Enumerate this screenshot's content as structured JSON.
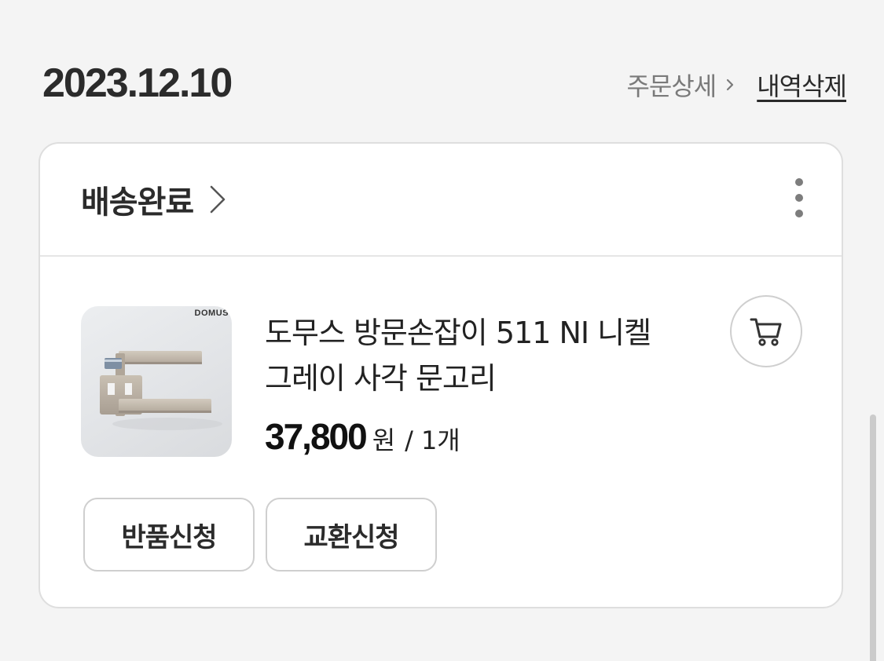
{
  "order": {
    "date": "2023.12.10",
    "detail_link": "주문상세",
    "delete_link": "내역삭제"
  },
  "shipment": {
    "status": "배송완료"
  },
  "product": {
    "brand_mark": "DOMUS",
    "name_line1": "도무스 방문손잡이 511 NI 니켈",
    "name_line2": "그레이 사각 문고리",
    "price": "37,800",
    "price_unit": "원",
    "separator": "/",
    "quantity": "1개"
  },
  "actions": {
    "return_label": "반품신청",
    "exchange_label": "교환신청"
  },
  "icons": {
    "detail_chevron": "chevron-right-icon",
    "status_chevron": "chevron-right-icon",
    "more": "more-vertical-icon",
    "cart": "cart-icon"
  },
  "colors": {
    "background": "#f4f4f4",
    "card": "#ffffff",
    "border": "#dedede",
    "muted_text": "#7a7a7a"
  }
}
